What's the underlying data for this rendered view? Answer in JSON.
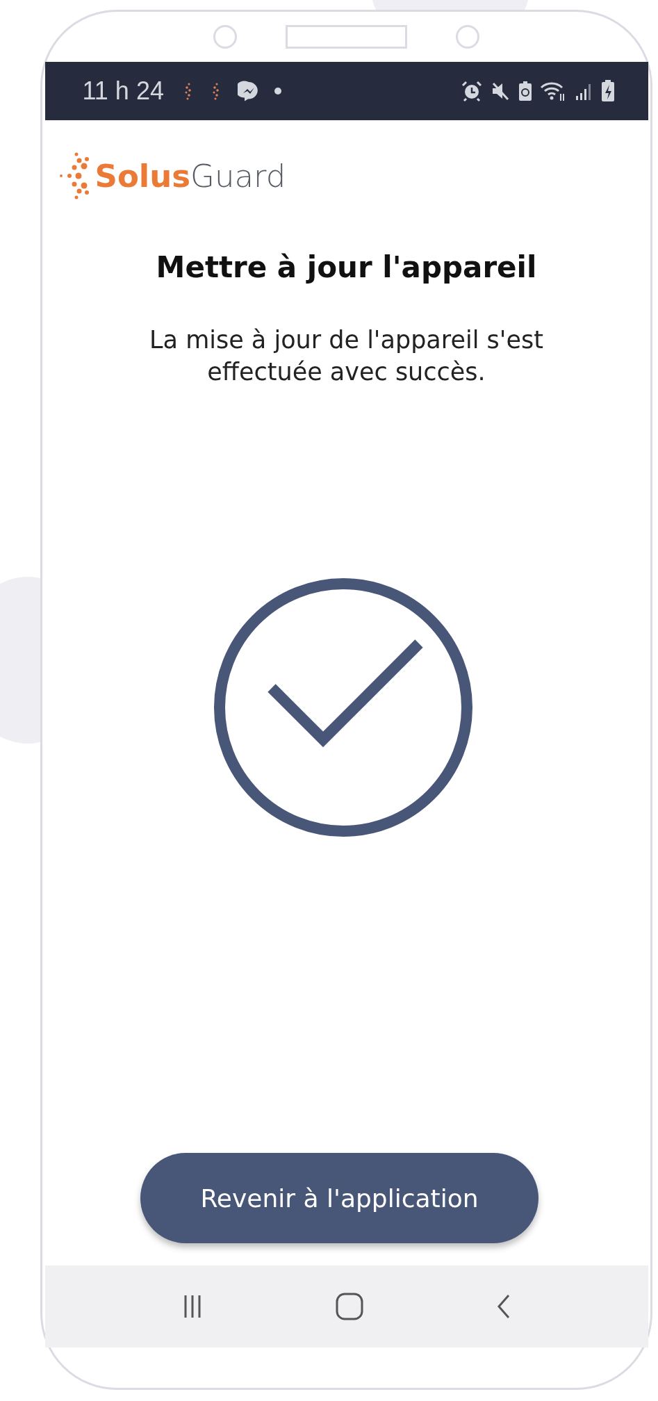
{
  "status_bar": {
    "time": "11 h 24"
  },
  "logo": {
    "primary": "Solus",
    "secondary": "Guard"
  },
  "title": "Mettre à jour l'appareil",
  "message": "La mise à jour de l'appareil s'est effectuée avec succès.",
  "button": {
    "label": "Revenir à l'application"
  }
}
